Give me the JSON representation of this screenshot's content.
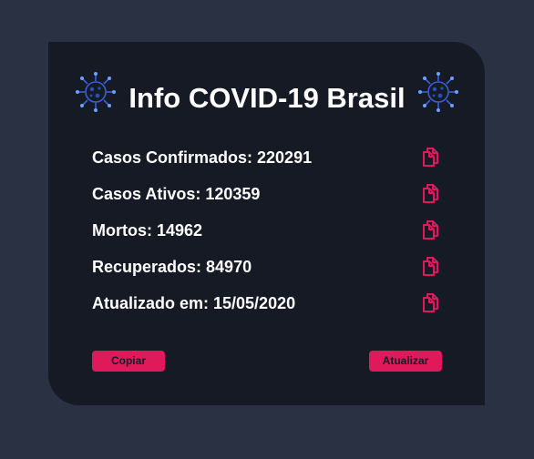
{
  "title": "Info COVID-19 Brasil",
  "stats": [
    {
      "label": "Casos Confirmados: 220291"
    },
    {
      "label": "Casos Ativos: 120359"
    },
    {
      "label": "Mortos: 14962"
    },
    {
      "label": "Recuperados: 84970"
    },
    {
      "label": "Atualizado em: 15/05/2020"
    }
  ],
  "buttons": {
    "copy_label": "Copiar",
    "refresh_label": "Atualizar"
  },
  "icons": {
    "header": "virus-icon",
    "row": "copy-icon"
  },
  "colors": {
    "background": "#2a3142",
    "card": "#161a25",
    "accent": "#e0195a",
    "text": "#ffffff",
    "virus": "#3a5fd8"
  }
}
